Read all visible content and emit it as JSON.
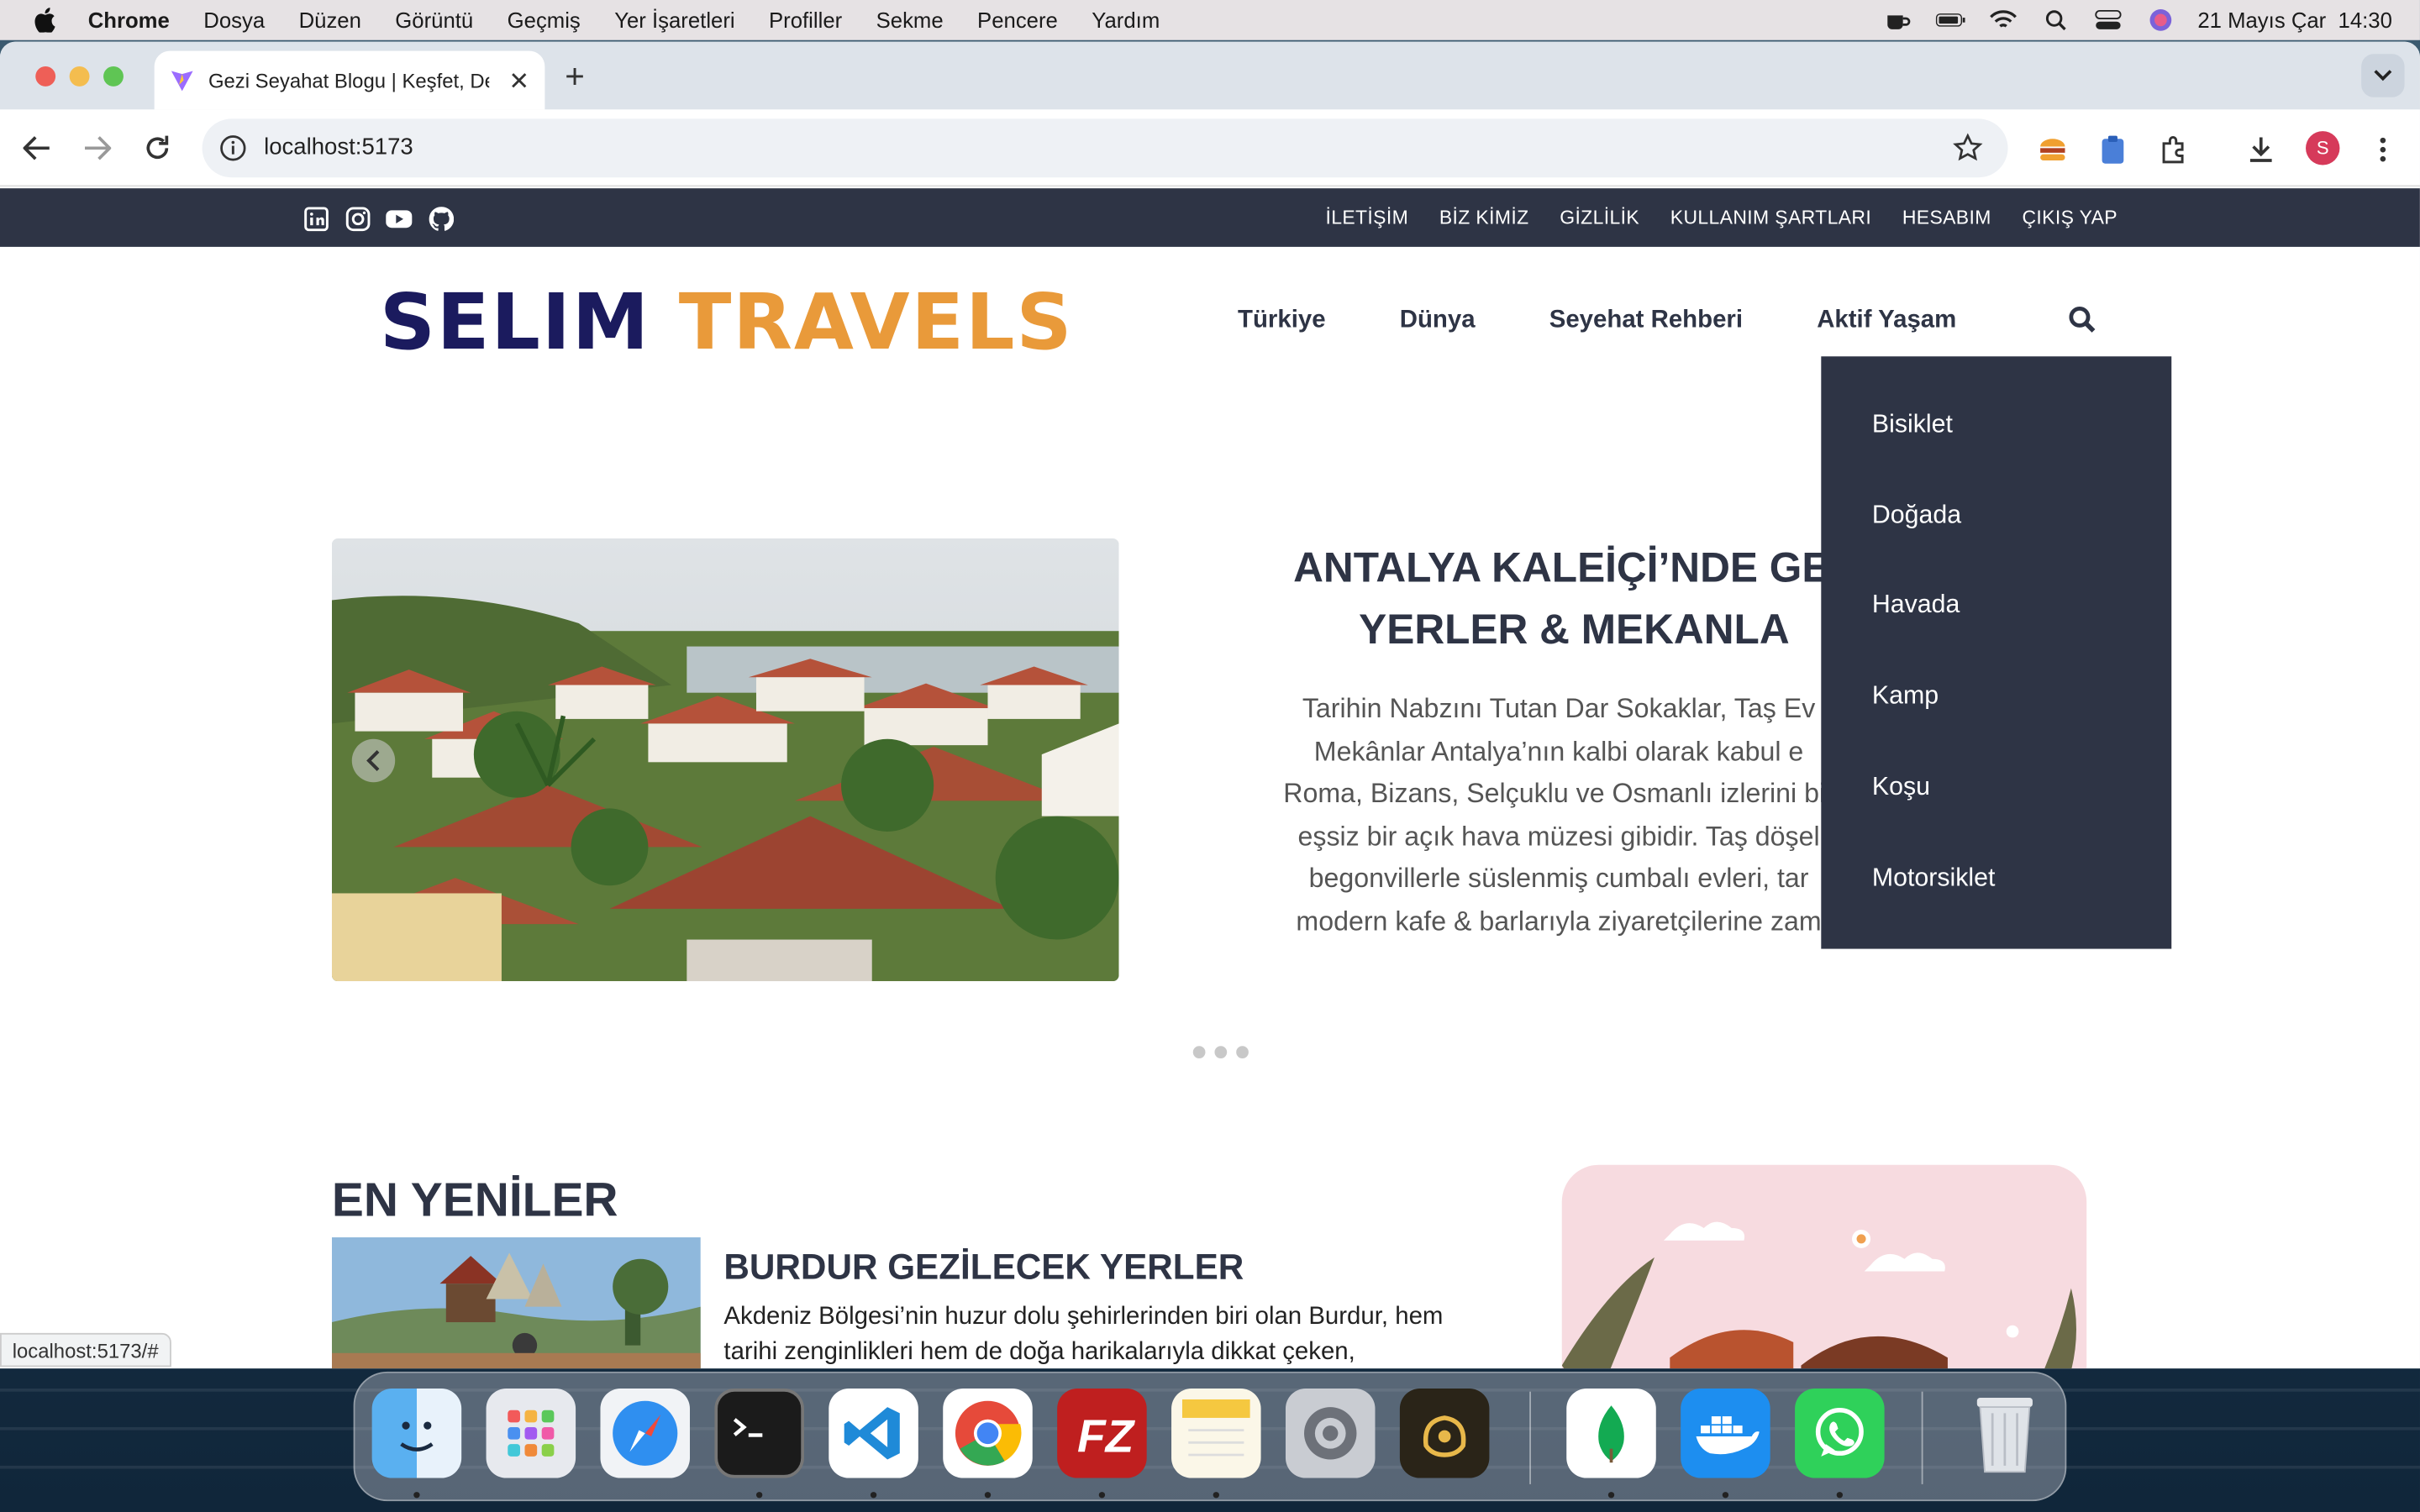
{
  "menubar": {
    "app": "Chrome",
    "items": [
      "Dosya",
      "Düzen",
      "Görüntü",
      "Geçmiş",
      "Yer İşaretleri",
      "Profiller",
      "Sekme",
      "Pencere",
      "Yardım"
    ],
    "datetime": "21 Mayıs Çar  14:30"
  },
  "browser": {
    "tab_title": "Gezi Seyahat Blogu | Keşfet, Deneyimle",
    "url": "localhost:5173",
    "profile_initial": "S",
    "status_url": "localhost:5173/#"
  },
  "site": {
    "top_links": [
      "İLETİŞİM",
      "BİZ KİMİZ",
      "GİZLİLİK",
      "KULLANIM ŞARTLARI",
      "HESABIM",
      "ÇIKIŞ YAP"
    ],
    "logo_part1": "SELIM",
    "logo_part2": "TRAVELS",
    "nav": [
      "Türkiye",
      "Dünya",
      "Seyehat Rehberi",
      "Aktif Yaşam"
    ],
    "dropdown": [
      "Bisiklet",
      "Doğada",
      "Havada",
      "Kamp",
      "Koşu",
      "Motorsiklet"
    ],
    "hero": {
      "title_line1": "ANTALYA KALEİÇİ’NDE GEZ",
      "title_line2": "YERLER & MEKANLA",
      "text_lines": [
        "Tarihin Nabzını Tutan Dar Sokaklar, Taş Ev",
        "Mekânlar Antalya’nın kalbi olarak kabul e",
        "Roma, Bizans, Selçuklu ve Osmanlı izlerini bir",
        "eşsiz bir açık hava müzesi gibidir. Taş döşel",
        "begonvillerle süslenmiş cumbalı evleri, tar",
        "modern kafe & barlarıyla ziyaretçilerine zam"
      ]
    },
    "latest": {
      "section_title": "EN YENİLER",
      "post_title": "BURDUR GEZİLECEK YERLER",
      "post_text_line1": "Akdeniz Bölgesi’nin huzur dolu şehirlerinden biri olan Burdur, hem",
      "post_text_line2": "tarihi zenginlikleri hem de doğa harikalarıyla dikkat çeken,"
    }
  }
}
